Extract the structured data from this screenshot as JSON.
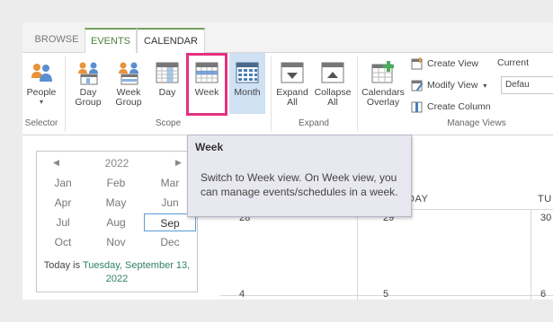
{
  "tabs": {
    "browse": "BROWSE",
    "events": "EVENTS",
    "calendar": "CALENDAR"
  },
  "ribbon": {
    "people": {
      "line1": "People",
      "line2": ""
    },
    "selector_group": "Selector",
    "day_group": {
      "line1": "Day",
      "line2": "Group"
    },
    "week_group": {
      "line1": "Week",
      "line2": "Group"
    },
    "day": "Day",
    "week": "Week",
    "month": "Month",
    "scope_group": "Scope",
    "expand_all": {
      "line1": "Expand",
      "line2": "All"
    },
    "collapse_all": {
      "line1": "Collapse",
      "line2": "All"
    },
    "expand_group": "Expand",
    "calendars_overlay": {
      "line1": "Calendars",
      "line2": "Overlay"
    },
    "create_view": "Create View",
    "modify_view": "Modify View",
    "create_column": "Create Column",
    "manage_views_group": "Manage Views",
    "current_view_label": "Current",
    "current_view_value": "Defau"
  },
  "picker": {
    "year": "2022",
    "months": [
      "Jan",
      "Feb",
      "Mar",
      "Apr",
      "May",
      "Jun",
      "Jul",
      "Aug",
      "Sep",
      "Oct",
      "Nov",
      "Dec"
    ],
    "selected_month": "Sep",
    "today_prefix": "Today is ",
    "today_date_line1": "Tuesday, September 13,",
    "today_date_line2": "2022"
  },
  "calendar": {
    "headers": [
      "DAY",
      "TU"
    ],
    "row1": [
      "28",
      "29",
      "30"
    ],
    "row2": [
      "4",
      "5",
      "6"
    ]
  },
  "tooltip": {
    "title": "Week",
    "body": "Switch to Week view. On Week view, you can manage events/schedules in a week."
  },
  "colors": {
    "tab_accent": "#75a05e",
    "highlight": "#e4317f",
    "active_button": "#cfe1f3",
    "today_link": "#2f7f6b"
  }
}
